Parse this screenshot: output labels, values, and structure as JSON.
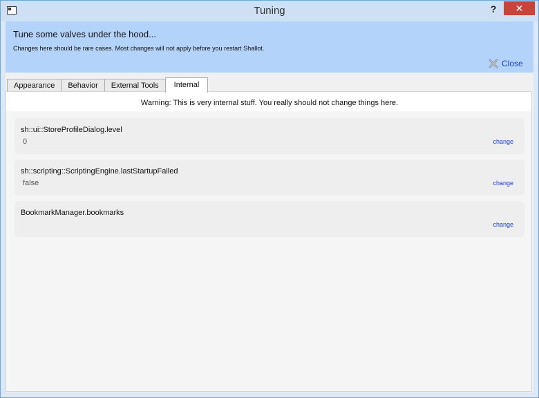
{
  "window": {
    "title": "Tuning",
    "help_label": "?",
    "close_label": "✕"
  },
  "banner": {
    "title": "Tune some valves under the hood...",
    "subtitle": "Changes here should be rare cases. Most changes will not apply before you restart Shallot.",
    "close_label": "Close",
    "close_icon": "x-icon"
  },
  "tabs": [
    {
      "label": "Appearance",
      "active": false
    },
    {
      "label": "Behavior",
      "active": false
    },
    {
      "label": "External Tools",
      "active": false
    },
    {
      "label": "Internal",
      "active": true
    }
  ],
  "internal": {
    "warning": "Warning: This is very internal stuff. You really should not change things here.",
    "settings": [
      {
        "key": "sh::ui::StoreProfileDialog.level",
        "value": "0",
        "action": "change"
      },
      {
        "key": "sh::scripting::ScriptingEngine.lastStartupFailed",
        "value": "false",
        "action": "change"
      },
      {
        "key": "BookmarkManager.bookmarks",
        "value": "",
        "action": "change"
      }
    ]
  },
  "colors": {
    "banner_bg": "#b3d3fa",
    "link": "#1a3ccc",
    "close_button": "#c7443a"
  }
}
